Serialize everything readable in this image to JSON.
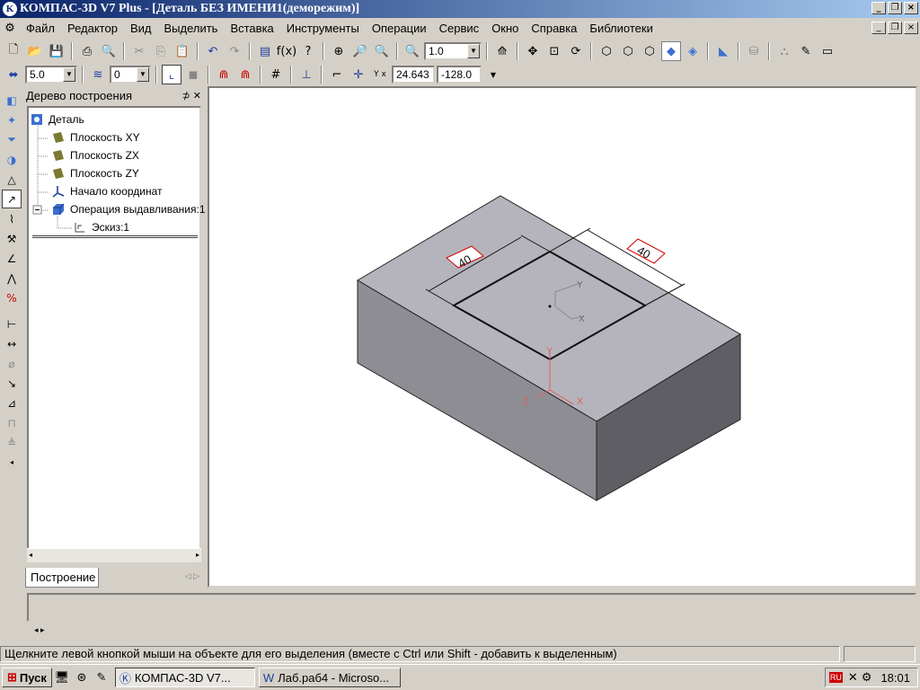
{
  "window": {
    "title": "КОМПАС-3D V7 Plus - [Деталь БЕЗ ИМЕНИ1(деморежим)]",
    "app_icon": "kompas-icon",
    "controls": [
      "_",
      "❐",
      "×"
    ],
    "doc_controls": [
      "_",
      "❐",
      "×"
    ]
  },
  "menu": [
    "Файл",
    "Редактор",
    "Вид",
    "Выделить",
    "Вставка",
    "Инструменты",
    "Операции",
    "Сервис",
    "Окно",
    "Справка",
    "Библиотеки"
  ],
  "toolbar": {
    "zoom_value": "1.0",
    "step_value": "5.0",
    "layer_value": "0",
    "coord_x": "24.643",
    "coord_y": "-128.0",
    "coord_label": "Y x"
  },
  "tree_panel": {
    "title": "Дерево построения",
    "pin": "⊅ ✕",
    "nodes": [
      {
        "label": "Деталь",
        "icon": "part-icon"
      },
      {
        "label": "Плоскость XY",
        "icon": "plane-icon"
      },
      {
        "label": "Плоскость ZX",
        "icon": "plane-icon"
      },
      {
        "label": "Плоскость ZY",
        "icon": "plane-icon"
      },
      {
        "label": "Начало координат",
        "icon": "origin-icon"
      },
      {
        "label": "Операция выдавливания:1",
        "icon": "extrude-icon"
      },
      {
        "label": "Эскиз:1",
        "icon": "sketch-icon"
      }
    ],
    "tab": "Построение"
  },
  "model": {
    "dim_left": "40",
    "dim_right": "40",
    "axis_x": "X",
    "axis_y": "Y",
    "axis_z": "Z",
    "sketch_x": "X",
    "sketch_y": "Y"
  },
  "status": {
    "text": "Щелкните левой кнопкой мыши на объекте для его выделения (вместе с Ctrl или Shift - добавить к выделенным)"
  },
  "taskbar": {
    "start": "Пуск",
    "tasks": [
      "КОМПАС-3D V7...",
      "Лаб.раб4 - Microso..."
    ],
    "clock": "18:01",
    "lang": "RU"
  },
  "colors": {
    "titlebar_start": "#0a246a",
    "titlebar_end": "#a6caf0",
    "model_top": "#b5b4bc",
    "model_front": "#8e8d94",
    "model_side": "#5f5e64",
    "dimension_red": "#d40000",
    "axis_red": "#e06060"
  }
}
